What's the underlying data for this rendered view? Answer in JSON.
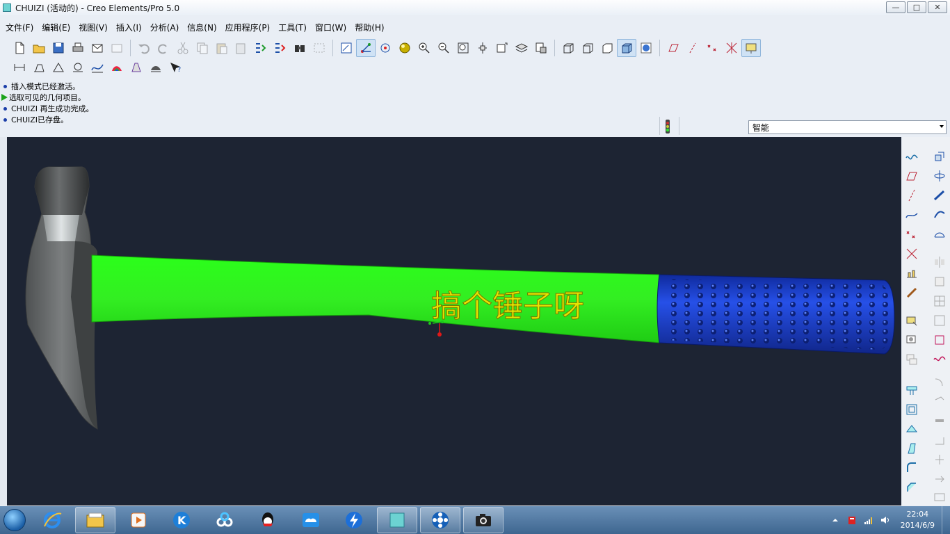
{
  "window": {
    "title": "CHUIZI (活动的) - Creo Elements/Pro 5.0",
    "controls": [
      "—",
      "□",
      "✕"
    ]
  },
  "menubar": [
    "文件(F)",
    "编辑(E)",
    "视图(V)",
    "插入(I)",
    "分析(A)",
    "信息(N)",
    "应用程序(P)",
    "工具(T)",
    "窗口(W)",
    "帮助(H)"
  ],
  "messages": [
    {
      "type": "info",
      "text": "插入模式已经激活。"
    },
    {
      "type": "prompt",
      "text": "选取可见的几何项目。"
    },
    {
      "type": "info",
      "text": "CHUIZI 再生成功完成。"
    },
    {
      "type": "info",
      "text": "CHUIZI已存盘。"
    }
  ],
  "filter": {
    "selected": "智能"
  },
  "model": {
    "name": "CHUIZI",
    "embossed_text": "搞个锤子呀",
    "colors": {
      "background": "#1d2433",
      "handle": "#33ee22",
      "grip": "#1a3fd0",
      "grip_dots": "#0b1e70",
      "head": "#6a6d6e",
      "text": "#e6e600",
      "datum_red": "#e01818",
      "datum_green": "#1ec81e"
    }
  },
  "taskbar": {
    "apps": [
      "ie-icon",
      "explorer-icon",
      "media-player-icon",
      "k-app-icon",
      "cloud-sync-icon",
      "qq-icon",
      "baidu-cloud-icon",
      "thunder-icon",
      "creo-icon",
      "video-icon",
      "camera-icon"
    ],
    "clock_time": "22:04",
    "clock_date": "2014/6/9"
  }
}
